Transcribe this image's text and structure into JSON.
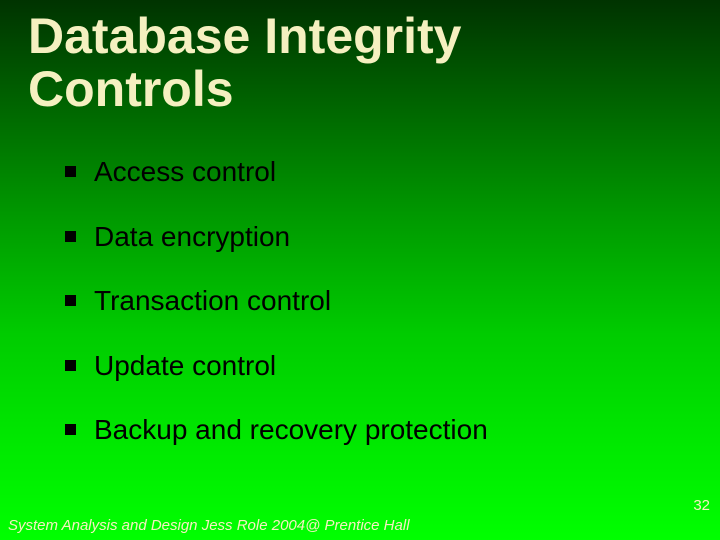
{
  "title": "Database Integrity Controls",
  "bullets": [
    {
      "text": "Access control"
    },
    {
      "text": "Data encryption"
    },
    {
      "text": "Transaction control"
    },
    {
      "text": "Update control"
    },
    {
      "text": "Backup and recovery protection"
    }
  ],
  "page_number": "32",
  "footer": "System Analysis and Design Jess Role 2004@ Prentice Hall"
}
